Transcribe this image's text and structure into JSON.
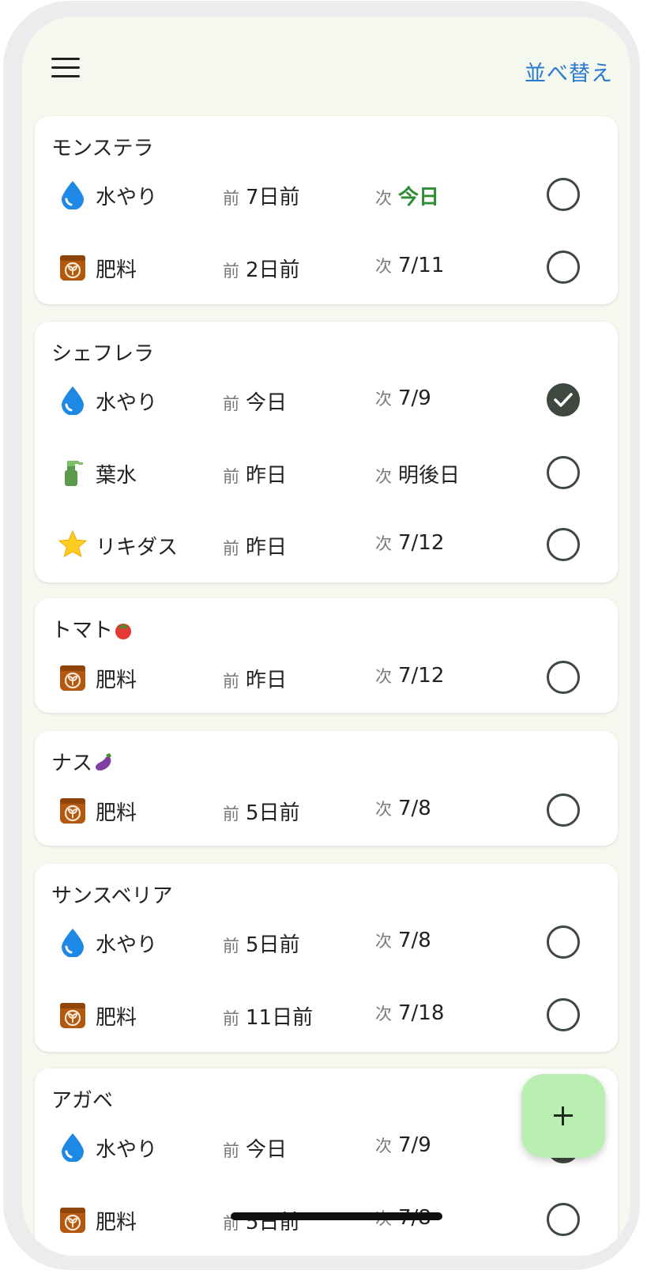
{
  "header": {
    "sort_label": "並べ替え"
  },
  "labels": {
    "prev_prefix": "前",
    "next_prefix": "次"
  },
  "colors": {
    "today_green": "#2e8b36",
    "accent_blue": "#2a7ad0",
    "fab_bg": "#b9efb0",
    "check_dark": "#3e4840"
  },
  "plants": [
    {
      "name": "モンステラ",
      "tasks": [
        {
          "icon": "water-drop-icon",
          "task": "水やり",
          "prev": "7日前",
          "next": "今日",
          "next_today": true,
          "done": false
        },
        {
          "icon": "fertilizer-bag-icon",
          "task": "肥料",
          "prev": "2日前",
          "next": "7/11",
          "done": false
        }
      ]
    },
    {
      "name": "シェフレラ",
      "tasks": [
        {
          "icon": "water-drop-icon",
          "task": "水やり",
          "prev": "今日",
          "next": "7/9",
          "done": true
        },
        {
          "icon": "spray-bottle-icon",
          "task": "葉水",
          "prev": "昨日",
          "next": "明後日",
          "done": false
        },
        {
          "icon": "star-icon",
          "task": "リキダス",
          "prev": "昨日",
          "next": "7/12",
          "done": false
        }
      ]
    },
    {
      "name": "トマト",
      "name_icon": "tomato-icon",
      "tasks": [
        {
          "icon": "fertilizer-bag-icon",
          "task": "肥料",
          "prev": "昨日",
          "next": "7/12",
          "done": false
        }
      ]
    },
    {
      "name": "ナス",
      "name_icon": "eggplant-icon",
      "tasks": [
        {
          "icon": "fertilizer-bag-icon",
          "task": "肥料",
          "prev": "5日前",
          "next": "7/8",
          "done": false
        }
      ]
    },
    {
      "name": "サンスベリア",
      "tasks": [
        {
          "icon": "water-drop-icon",
          "task": "水やり",
          "prev": "5日前",
          "next": "7/8",
          "done": false
        },
        {
          "icon": "fertilizer-bag-icon",
          "task": "肥料",
          "prev": "11日前",
          "next": "7/18",
          "done": false
        }
      ]
    },
    {
      "name": "アガベ",
      "tasks": [
        {
          "icon": "water-drop-icon",
          "task": "水やり",
          "prev": "今日",
          "next": "7/9",
          "done": true
        },
        {
          "icon": "fertilizer-bag-icon",
          "task": "肥料",
          "prev": "5日前",
          "next": "7/8",
          "done": false
        }
      ]
    }
  ],
  "fab": {
    "icon": "plus-icon"
  }
}
